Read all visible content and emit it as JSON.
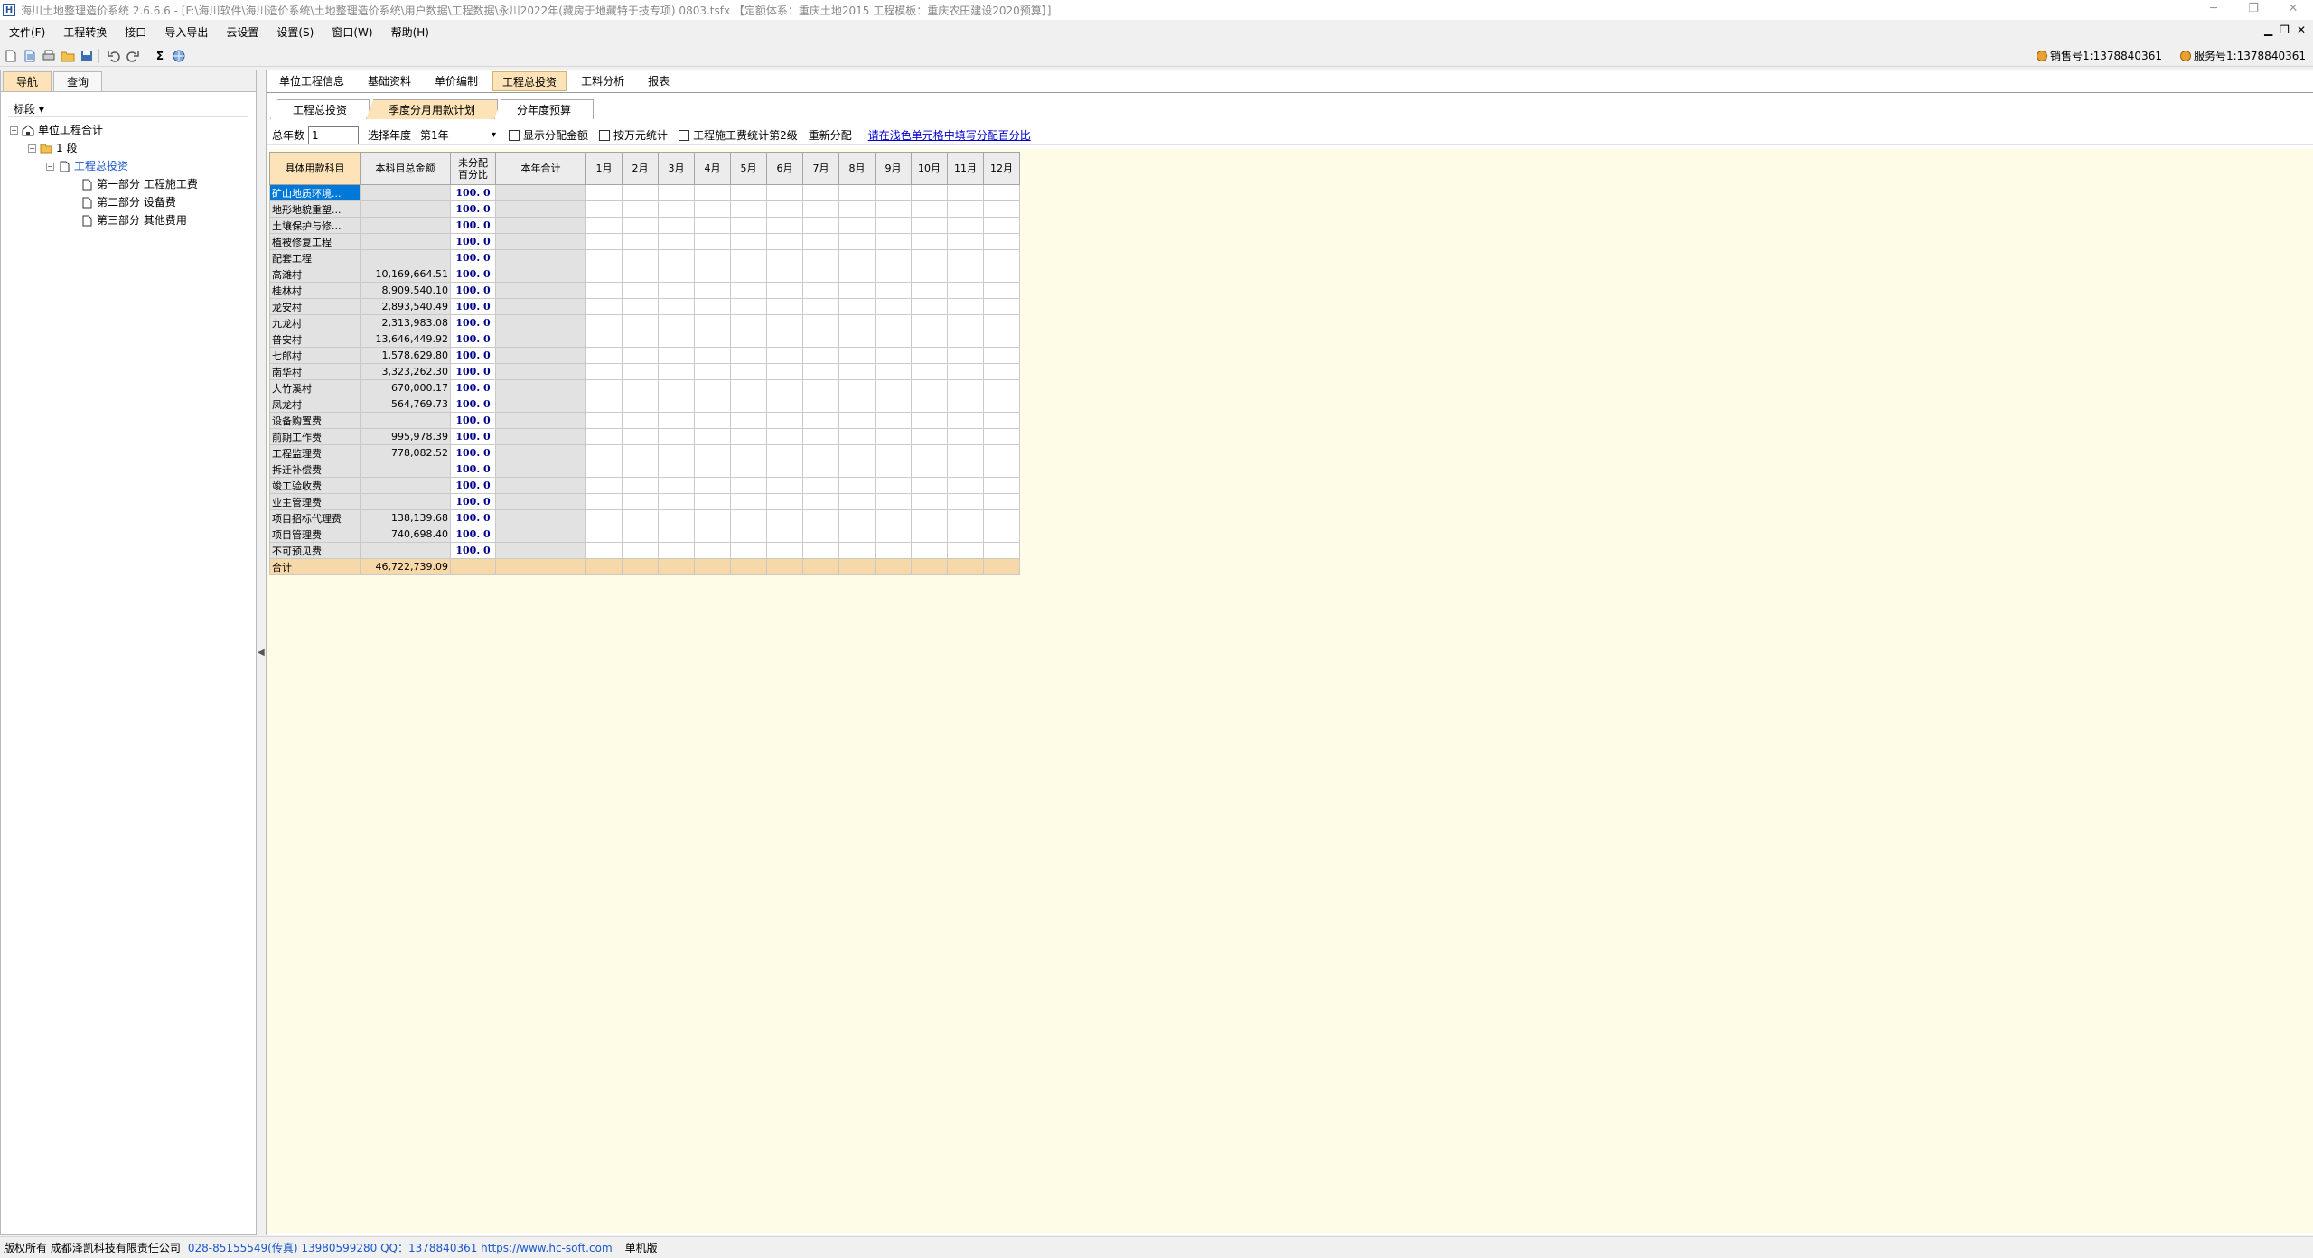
{
  "window": {
    "title": "海川土地整理造价系统 2.6.6.6 - [F:\\海川软件\\海川造价系统\\土地整理造价系统\\用户数据\\工程数据\\永川2022年(藏房于地藏特于技专项) 0803.tsfx 【定额体系：重庆土地2015  工程模板：重庆农田建设2020预算】]",
    "app_icon": "H",
    "min": "─",
    "max": "❐",
    "close": "✕"
  },
  "menu": {
    "items": [
      "文件(F)",
      "工程转换",
      "接口",
      "导入导出",
      "云设置",
      "设置(S)",
      "窗口(W)",
      "帮助(H)"
    ],
    "mdi": [
      "▁",
      "❐",
      "✕"
    ]
  },
  "toolbar": {
    "icons": [
      "new-icon",
      "open-icon",
      "print-icon",
      "folder-icon",
      "save-icon",
      "undo-icon",
      "redo-icon",
      "sum-icon",
      "globe-icon"
    ],
    "sum": "Σ",
    "sales": "销售号1:1378840361",
    "service": "服务号1:1378840361"
  },
  "left": {
    "tabs": [
      "导航",
      "查询"
    ],
    "stage": "标段 ▾",
    "tree": [
      {
        "label": "单位工程合计",
        "level": 0,
        "toggle": "⊟",
        "icon": "home-icon"
      },
      {
        "label": "1 段",
        "level": 1,
        "toggle": "⊟",
        "icon": "folder-icon"
      },
      {
        "label": "工程总投资",
        "level": 2,
        "toggle": "⊟",
        "icon": "doc-icon",
        "selected": true
      },
      {
        "label": "第一部分 工程施工费",
        "level": 3,
        "toggle": "",
        "icon": "doc-icon"
      },
      {
        "label": "第二部分 设备费",
        "level": 3,
        "toggle": "",
        "icon": "doc-icon"
      },
      {
        "label": "第三部分 其他费用",
        "level": 3,
        "toggle": "",
        "icon": "doc-icon"
      }
    ]
  },
  "main": {
    "tabs": [
      "单位工程信息",
      "基础资料",
      "单价编制",
      "工程总投资",
      "工料分析",
      "报表"
    ],
    "active_tab": 3,
    "subtabs": [
      "工程总投资",
      "季度分月用款计划",
      "分年度预算"
    ],
    "active_subtab": 1,
    "controls": {
      "years_label": "总年数",
      "years_value": "1",
      "year_select_label": "选择年度",
      "year_select_value": "第1年",
      "cb_show_amount": "显示分配金额",
      "cb_wan": "按万元统计",
      "cb_level2": "工程施工费统计第2级",
      "redistribute": "重新分配",
      "hint_link": "请在浅色单元格中填写分配百分比"
    },
    "grid": {
      "headers": [
        "具体用款科目",
        "本科目总金额",
        "未分配\n百分比",
        "本年合计",
        "1月",
        "2月",
        "3月",
        "4月",
        "5月",
        "6月",
        "7月",
        "8月",
        "9月",
        "10月",
        "11月",
        "12月"
      ],
      "rows": [
        {
          "name": "矿山地质环境...",
          "amount": "",
          "pct": "100. 0"
        },
        {
          "name": "地形地貌重塑...",
          "amount": "",
          "pct": "100. 0"
        },
        {
          "name": "土壤保护与修...",
          "amount": "",
          "pct": "100. 0"
        },
        {
          "name": "植被修复工程",
          "amount": "",
          "pct": "100. 0"
        },
        {
          "name": "配套工程",
          "amount": "",
          "pct": "100. 0"
        },
        {
          "name": "高滩村",
          "amount": "10,169,664.51",
          "pct": "100. 0"
        },
        {
          "name": "桂林村",
          "amount": "8,909,540.10",
          "pct": "100. 0"
        },
        {
          "name": "龙安村",
          "amount": "2,893,540.49",
          "pct": "100. 0"
        },
        {
          "name": "九龙村",
          "amount": "2,313,983.08",
          "pct": "100. 0"
        },
        {
          "name": "普安村",
          "amount": "13,646,449.92",
          "pct": "100. 0"
        },
        {
          "name": "七郎村",
          "amount": "1,578,629.80",
          "pct": "100. 0"
        },
        {
          "name": "南华村",
          "amount": "3,323,262.30",
          "pct": "100. 0"
        },
        {
          "name": "大竹溪村",
          "amount": "670,000.17",
          "pct": "100. 0"
        },
        {
          "name": "凤龙村",
          "amount": "564,769.73",
          "pct": "100. 0"
        },
        {
          "name": "设备购置费",
          "amount": "",
          "pct": "100. 0"
        },
        {
          "name": "前期工作费",
          "amount": "995,978.39",
          "pct": "100. 0"
        },
        {
          "name": "工程监理费",
          "amount": "778,082.52",
          "pct": "100. 0"
        },
        {
          "name": "拆迁补偿费",
          "amount": "",
          "pct": "100. 0"
        },
        {
          "name": "竣工验收费",
          "amount": "",
          "pct": "100. 0"
        },
        {
          "name": "业主管理费",
          "amount": "",
          "pct": "100. 0"
        },
        {
          "name": "项目招标代理费",
          "amount": "138,139.68",
          "pct": "100. 0"
        },
        {
          "name": "项目管理费",
          "amount": "740,698.40",
          "pct": "100. 0"
        },
        {
          "name": "不可预见费",
          "amount": "",
          "pct": "100. 0"
        }
      ],
      "total": {
        "name": "合计",
        "amount": "46,722,739.09"
      }
    }
  },
  "status": {
    "copyright": "版权所有 成都泽凯科技有限责任公司",
    "contact": "028-85155549(传真) 13980599280 QQ：1378840361  https://www.hc-soft.com",
    "mode": "单机版"
  },
  "colors": {
    "accent_tab": "#fde3b7",
    "selection": "#0078d7",
    "grid_bg": "#fefbe6",
    "pct_text": "#00008b"
  }
}
